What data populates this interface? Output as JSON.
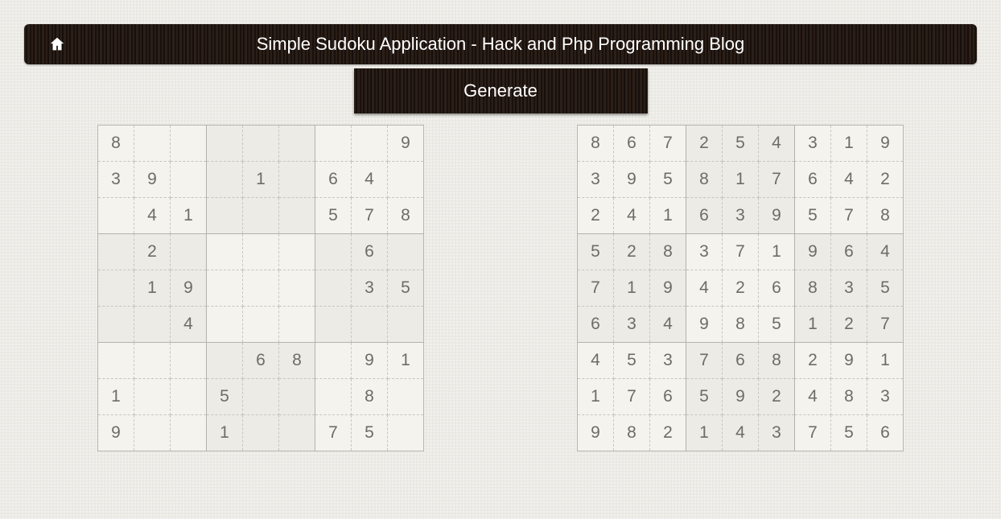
{
  "header": {
    "title": "Simple Sudoku Application - Hack and Php Programming Blog",
    "home_icon": "home-icon"
  },
  "buttons": {
    "generate": "Generate"
  },
  "sudoku": {
    "puzzle": [
      [
        "8",
        "",
        "",
        "",
        "",
        "",
        "",
        "",
        "9"
      ],
      [
        "3",
        "9",
        "",
        "",
        "1",
        "",
        "6",
        "4",
        ""
      ],
      [
        "",
        "4",
        "1",
        "",
        "",
        "",
        "5",
        "7",
        "8"
      ],
      [
        "",
        "2",
        "",
        "",
        "",
        "",
        "",
        "6",
        ""
      ],
      [
        "",
        "1",
        "9",
        "",
        "",
        "",
        "",
        "3",
        "5"
      ],
      [
        "",
        "",
        "4",
        "",
        "",
        "",
        "",
        "",
        ""
      ],
      [
        "",
        "",
        "",
        "",
        "6",
        "8",
        "",
        "9",
        "1"
      ],
      [
        "1",
        "",
        "",
        "5",
        "",
        "",
        "",
        "8",
        ""
      ],
      [
        "9",
        "",
        "",
        "1",
        "",
        "",
        "7",
        "5",
        ""
      ]
    ],
    "solution": [
      [
        "8",
        "6",
        "7",
        "2",
        "5",
        "4",
        "3",
        "1",
        "9"
      ],
      [
        "3",
        "9",
        "5",
        "8",
        "1",
        "7",
        "6",
        "4",
        "2"
      ],
      [
        "2",
        "4",
        "1",
        "6",
        "3",
        "9",
        "5",
        "7",
        "8"
      ],
      [
        "5",
        "2",
        "8",
        "3",
        "7",
        "1",
        "9",
        "6",
        "4"
      ],
      [
        "7",
        "1",
        "9",
        "4",
        "2",
        "6",
        "8",
        "3",
        "5"
      ],
      [
        "6",
        "3",
        "4",
        "9",
        "8",
        "5",
        "1",
        "2",
        "7"
      ],
      [
        "4",
        "5",
        "3",
        "7",
        "6",
        "8",
        "2",
        "9",
        "1"
      ],
      [
        "1",
        "7",
        "6",
        "5",
        "9",
        "2",
        "4",
        "8",
        "3"
      ],
      [
        "9",
        "8",
        "2",
        "1",
        "4",
        "3",
        "7",
        "5",
        "6"
      ]
    ]
  }
}
